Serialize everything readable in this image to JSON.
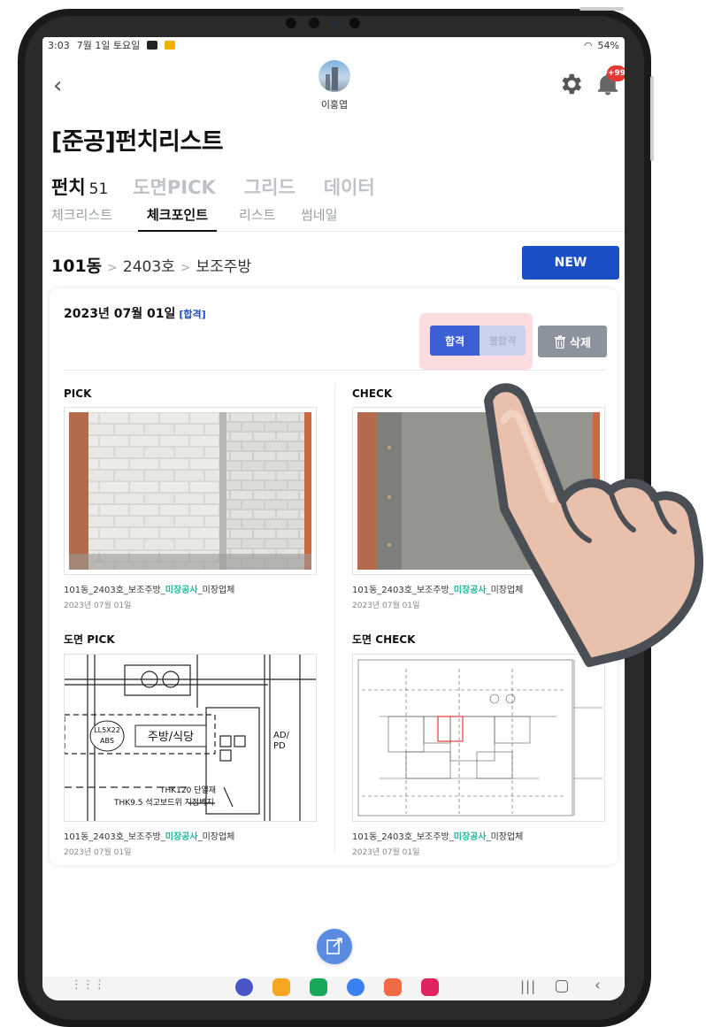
{
  "status_bar": {
    "time": "3:03",
    "date": "7월 1일 토요일",
    "battery": "54%"
  },
  "header": {
    "username": "이홍엽",
    "notification_badge": "+99"
  },
  "page_title": "[준공]펀치리스트",
  "main_tabs": [
    {
      "label": "펀치",
      "count": "51",
      "active": true
    },
    {
      "label": "도면PICK"
    },
    {
      "label": "그리드"
    },
    {
      "label": "데이터"
    }
  ],
  "sub_tabs": [
    {
      "label": "체크리스트"
    },
    {
      "label": "체크포인트",
      "active": true
    },
    {
      "label": "리스트"
    },
    {
      "label": "썸네일"
    }
  ],
  "breadcrumb": {
    "building": "101동",
    "unit": "2403호",
    "room": "보조주방",
    "separator": ">"
  },
  "new_button": "NEW",
  "card": {
    "date": "2023년 07월 01일",
    "status": "[합격]",
    "pass_label": "합격",
    "fail_label": "불합격",
    "delete_label": "삭제",
    "photos": [
      {
        "label": "PICK",
        "caption_pre": "101동_2403호_보조주방_",
        "trade": "미장공사",
        "caption_post": "_미장업체",
        "date": "2023년 07월 01일"
      },
      {
        "label": "CHECK",
        "caption_pre": "101동_2403호_보조주방_",
        "trade": "미장공사",
        "caption_post": "_미장업체",
        "date": "2023년 07월 01일"
      },
      {
        "label": "도면 PICK",
        "caption_pre": "101동_2403호_보조주방_",
        "trade": "미장공사",
        "caption_post": "_미장업체",
        "date": "2023년 07월 01일"
      },
      {
        "label": "도면 CHECK",
        "caption_pre": "101동_2403호_보조주방_",
        "trade": "미장공사",
        "caption_post": "_미장업체",
        "date": "2023년 07월 01일"
      }
    ],
    "drawing_text": {
      "room": "주방/식당",
      "tag_left": "LL5X22",
      "tag_abs": "ABS",
      "ad_pd_1": "AD/",
      "ad_pd_2": "PD",
      "note1": "THK120 단열재",
      "note2": "THK9.5 석고보드위 지정벽지"
    }
  },
  "colors": {
    "primary": "#1b4fc7",
    "trade": "#1fb79a",
    "highlight": "#fbdde0",
    "delete": "#8c939c"
  }
}
